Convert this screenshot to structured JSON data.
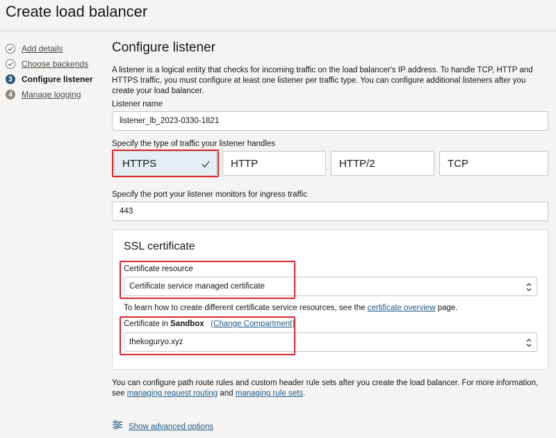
{
  "page": {
    "title": "Create load balancer"
  },
  "steps": [
    {
      "number": "1",
      "label": "Add details",
      "state": "done"
    },
    {
      "number": "2",
      "label": "Choose backends",
      "state": "done"
    },
    {
      "number": "3",
      "label": "Configure listener",
      "state": "current"
    },
    {
      "number": "4",
      "label": "Manage logging",
      "state": "pending"
    }
  ],
  "main": {
    "section_title": "Configure listener",
    "intro": "A listener is a logical entity that checks for incoming traffic on the load balancer's IP address. To handle TCP, HTTP and HTTPS traffic, you must configure at least one listener per traffic type. You can configure additional listeners after you create your load balancer.",
    "listener_name": {
      "label": "Listener name",
      "value": "listener_lb_2023-0330-1821"
    },
    "traffic_type": {
      "label": "Specify the type of traffic your listener handles",
      "options": [
        "HTTPS",
        "HTTP",
        "HTTP/2",
        "TCP"
      ],
      "selected": "HTTPS"
    },
    "port": {
      "label": "Specify the port your listener monitors for ingress traffic",
      "value": "443"
    },
    "ssl": {
      "title": "SSL certificate",
      "resource_label": "Certificate resource",
      "resource_value": "Certificate service managed certificate",
      "help_prefix": "To learn how to create different certificate service resources, see the",
      "help_link": "certificate overview",
      "help_suffix": "page.",
      "cert_label_prefix": "Certificate in",
      "compartment": "Sandbox",
      "change_compartment": "(Change Compartment)",
      "cert_value": "thekoguryo.xyz"
    },
    "footer_text": "You can configure path route rules and custom header rule sets after you create the load balancer. For more information, see",
    "footer_link1": "managing request routing",
    "footer_and": "and",
    "footer_link2": "managing rule sets",
    "footer_period": ".",
    "advanced_options": "Show advanced options"
  },
  "colors": {
    "accent": "#2c5a78",
    "link": "#1d5b87",
    "highlight": "#d9262d",
    "selected_tile": "#e4eff5"
  }
}
